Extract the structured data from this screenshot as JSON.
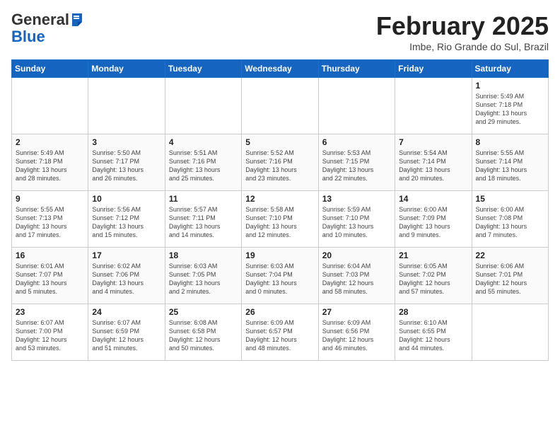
{
  "header": {
    "logo_line1": "General",
    "logo_line2": "Blue",
    "month_year": "February 2025",
    "location": "Imbe, Rio Grande do Sul, Brazil"
  },
  "weekdays": [
    "Sunday",
    "Monday",
    "Tuesday",
    "Wednesday",
    "Thursday",
    "Friday",
    "Saturday"
  ],
  "weeks": [
    [
      {
        "day": "",
        "info": ""
      },
      {
        "day": "",
        "info": ""
      },
      {
        "day": "",
        "info": ""
      },
      {
        "day": "",
        "info": ""
      },
      {
        "day": "",
        "info": ""
      },
      {
        "day": "",
        "info": ""
      },
      {
        "day": "1",
        "info": "Sunrise: 5:49 AM\nSunset: 7:18 PM\nDaylight: 13 hours\nand 29 minutes."
      }
    ],
    [
      {
        "day": "2",
        "info": "Sunrise: 5:49 AM\nSunset: 7:18 PM\nDaylight: 13 hours\nand 28 minutes."
      },
      {
        "day": "3",
        "info": "Sunrise: 5:50 AM\nSunset: 7:17 PM\nDaylight: 13 hours\nand 26 minutes."
      },
      {
        "day": "4",
        "info": "Sunrise: 5:51 AM\nSunset: 7:16 PM\nDaylight: 13 hours\nand 25 minutes."
      },
      {
        "day": "5",
        "info": "Sunrise: 5:52 AM\nSunset: 7:16 PM\nDaylight: 13 hours\nand 23 minutes."
      },
      {
        "day": "6",
        "info": "Sunrise: 5:53 AM\nSunset: 7:15 PM\nDaylight: 13 hours\nand 22 minutes."
      },
      {
        "day": "7",
        "info": "Sunrise: 5:54 AM\nSunset: 7:14 PM\nDaylight: 13 hours\nand 20 minutes."
      },
      {
        "day": "8",
        "info": "Sunrise: 5:55 AM\nSunset: 7:14 PM\nDaylight: 13 hours\nand 18 minutes."
      }
    ],
    [
      {
        "day": "9",
        "info": "Sunrise: 5:55 AM\nSunset: 7:13 PM\nDaylight: 13 hours\nand 17 minutes."
      },
      {
        "day": "10",
        "info": "Sunrise: 5:56 AM\nSunset: 7:12 PM\nDaylight: 13 hours\nand 15 minutes."
      },
      {
        "day": "11",
        "info": "Sunrise: 5:57 AM\nSunset: 7:11 PM\nDaylight: 13 hours\nand 14 minutes."
      },
      {
        "day": "12",
        "info": "Sunrise: 5:58 AM\nSunset: 7:10 PM\nDaylight: 13 hours\nand 12 minutes."
      },
      {
        "day": "13",
        "info": "Sunrise: 5:59 AM\nSunset: 7:10 PM\nDaylight: 13 hours\nand 10 minutes."
      },
      {
        "day": "14",
        "info": "Sunrise: 6:00 AM\nSunset: 7:09 PM\nDaylight: 13 hours\nand 9 minutes."
      },
      {
        "day": "15",
        "info": "Sunrise: 6:00 AM\nSunset: 7:08 PM\nDaylight: 13 hours\nand 7 minutes."
      }
    ],
    [
      {
        "day": "16",
        "info": "Sunrise: 6:01 AM\nSunset: 7:07 PM\nDaylight: 13 hours\nand 5 minutes."
      },
      {
        "day": "17",
        "info": "Sunrise: 6:02 AM\nSunset: 7:06 PM\nDaylight: 13 hours\nand 4 minutes."
      },
      {
        "day": "18",
        "info": "Sunrise: 6:03 AM\nSunset: 7:05 PM\nDaylight: 13 hours\nand 2 minutes."
      },
      {
        "day": "19",
        "info": "Sunrise: 6:03 AM\nSunset: 7:04 PM\nDaylight: 13 hours\nand 0 minutes."
      },
      {
        "day": "20",
        "info": "Sunrise: 6:04 AM\nSunset: 7:03 PM\nDaylight: 12 hours\nand 58 minutes."
      },
      {
        "day": "21",
        "info": "Sunrise: 6:05 AM\nSunset: 7:02 PM\nDaylight: 12 hours\nand 57 minutes."
      },
      {
        "day": "22",
        "info": "Sunrise: 6:06 AM\nSunset: 7:01 PM\nDaylight: 12 hours\nand 55 minutes."
      }
    ],
    [
      {
        "day": "23",
        "info": "Sunrise: 6:07 AM\nSunset: 7:00 PM\nDaylight: 12 hours\nand 53 minutes."
      },
      {
        "day": "24",
        "info": "Sunrise: 6:07 AM\nSunset: 6:59 PM\nDaylight: 12 hours\nand 51 minutes."
      },
      {
        "day": "25",
        "info": "Sunrise: 6:08 AM\nSunset: 6:58 PM\nDaylight: 12 hours\nand 50 minutes."
      },
      {
        "day": "26",
        "info": "Sunrise: 6:09 AM\nSunset: 6:57 PM\nDaylight: 12 hours\nand 48 minutes."
      },
      {
        "day": "27",
        "info": "Sunrise: 6:09 AM\nSunset: 6:56 PM\nDaylight: 12 hours\nand 46 minutes."
      },
      {
        "day": "28",
        "info": "Sunrise: 6:10 AM\nSunset: 6:55 PM\nDaylight: 12 hours\nand 44 minutes."
      },
      {
        "day": "",
        "info": ""
      }
    ]
  ]
}
